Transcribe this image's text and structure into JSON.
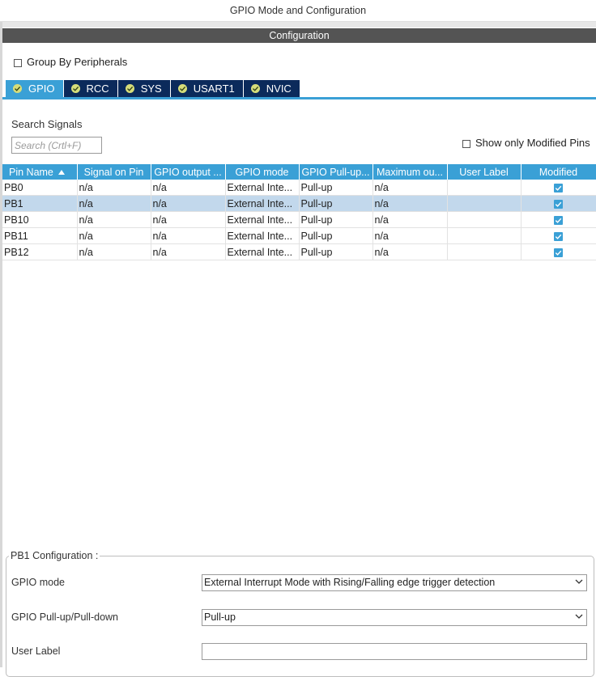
{
  "window": {
    "title": "GPIO Mode and Configuration"
  },
  "section": {
    "header": "Configuration"
  },
  "group_by": {
    "label": "Group By Peripherals",
    "checked": false
  },
  "tabs": [
    {
      "label": "GPIO",
      "icon": "check-circle-icon",
      "active": true
    },
    {
      "label": "RCC",
      "icon": "check-circle-icon",
      "active": false
    },
    {
      "label": "SYS",
      "icon": "check-circle-icon",
      "active": false
    },
    {
      "label": "USART1",
      "icon": "check-circle-icon",
      "active": false
    },
    {
      "label": "NVIC",
      "icon": "check-circle-icon",
      "active": false
    }
  ],
  "search": {
    "label": "Search Signals",
    "placeholder": "Search (Crtl+F)",
    "value": ""
  },
  "show_modified": {
    "label": "Show only Modified Pins",
    "checked": false
  },
  "table": {
    "columns": [
      "Pin Name",
      "Signal on Pin",
      "GPIO output ...",
      "GPIO mode",
      "GPIO Pull-up...",
      "Maximum ou...",
      "User Label",
      "Modified"
    ],
    "sorted_column": "Pin Name",
    "rows": [
      {
        "pin": "PB0",
        "signal": "n/a",
        "output": "n/a",
        "mode": "External Inte...",
        "pull": "Pull-up",
        "speed": "n/a",
        "label": "",
        "modified": true,
        "selected": false
      },
      {
        "pin": "PB1",
        "signal": "n/a",
        "output": "n/a",
        "mode": "External Inte...",
        "pull": "Pull-up",
        "speed": "n/a",
        "label": "",
        "modified": true,
        "selected": true
      },
      {
        "pin": "PB10",
        "signal": "n/a",
        "output": "n/a",
        "mode": "External Inte...",
        "pull": "Pull-up",
        "speed": "n/a",
        "label": "",
        "modified": true,
        "selected": false
      },
      {
        "pin": "PB11",
        "signal": "n/a",
        "output": "n/a",
        "mode": "External Inte...",
        "pull": "Pull-up",
        "speed": "n/a",
        "label": "",
        "modified": true,
        "selected": false
      },
      {
        "pin": "PB12",
        "signal": "n/a",
        "output": "n/a",
        "mode": "External Inte...",
        "pull": "Pull-up",
        "speed": "n/a",
        "label": "",
        "modified": true,
        "selected": false
      }
    ]
  },
  "pin_config": {
    "legend": "PB1 Configuration :",
    "gpio_mode": {
      "label": "GPIO mode",
      "value": "External Interrupt Mode with Rising/Falling edge trigger detection"
    },
    "gpio_pull": {
      "label": "GPIO Pull-up/Pull-down",
      "value": "Pull-up"
    },
    "user_label": {
      "label": "User Label",
      "value": ""
    }
  },
  "colors": {
    "accent": "#3aa0d6",
    "tab_dark": "#0b2a5b",
    "header_bar": "#545454",
    "selected_row": "#c2d8ec",
    "tab_icon": "#d6dd7a"
  }
}
